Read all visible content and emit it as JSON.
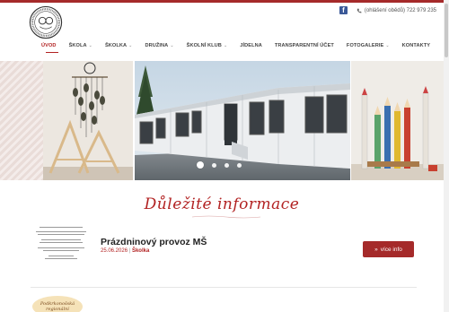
{
  "header": {
    "facebook_label": "f",
    "phone_text": "(ohlášení obědů) 722 979 235"
  },
  "nav": {
    "items": [
      {
        "label": "ÚVOD",
        "active": true,
        "has_dropdown": false
      },
      {
        "label": "ŠKOLA",
        "active": false,
        "has_dropdown": true
      },
      {
        "label": "ŠKOLKA",
        "active": false,
        "has_dropdown": true
      },
      {
        "label": "DRUŽINA",
        "active": false,
        "has_dropdown": true
      },
      {
        "label": "ŠKOLNÍ KLUB",
        "active": false,
        "has_dropdown": true
      },
      {
        "label": "JÍDELNA",
        "active": false,
        "has_dropdown": false
      },
      {
        "label": "TRANSPARENTNÍ ÚČET",
        "active": false,
        "has_dropdown": false
      },
      {
        "label": "FOTOGALERIE",
        "active": false,
        "has_dropdown": true
      },
      {
        "label": "KONTAKTY",
        "active": false,
        "has_dropdown": false
      }
    ],
    "caret": "⌄"
  },
  "slider": {
    "dot_count": 4,
    "active_dot": 0
  },
  "section": {
    "title": "Důležité informace"
  },
  "news": [
    {
      "title": "Prázdninový provoz MŠ",
      "date": "25.06.2026",
      "separator": "|",
      "category": "Školka",
      "button_label": "více info",
      "button_icon": "»"
    }
  ],
  "badge": {
    "line1": "Podkrkonošská",
    "line2": "regionální"
  },
  "colors": {
    "accent": "#b22222",
    "button": "#a52a2a",
    "facebook": "#3b5998"
  }
}
